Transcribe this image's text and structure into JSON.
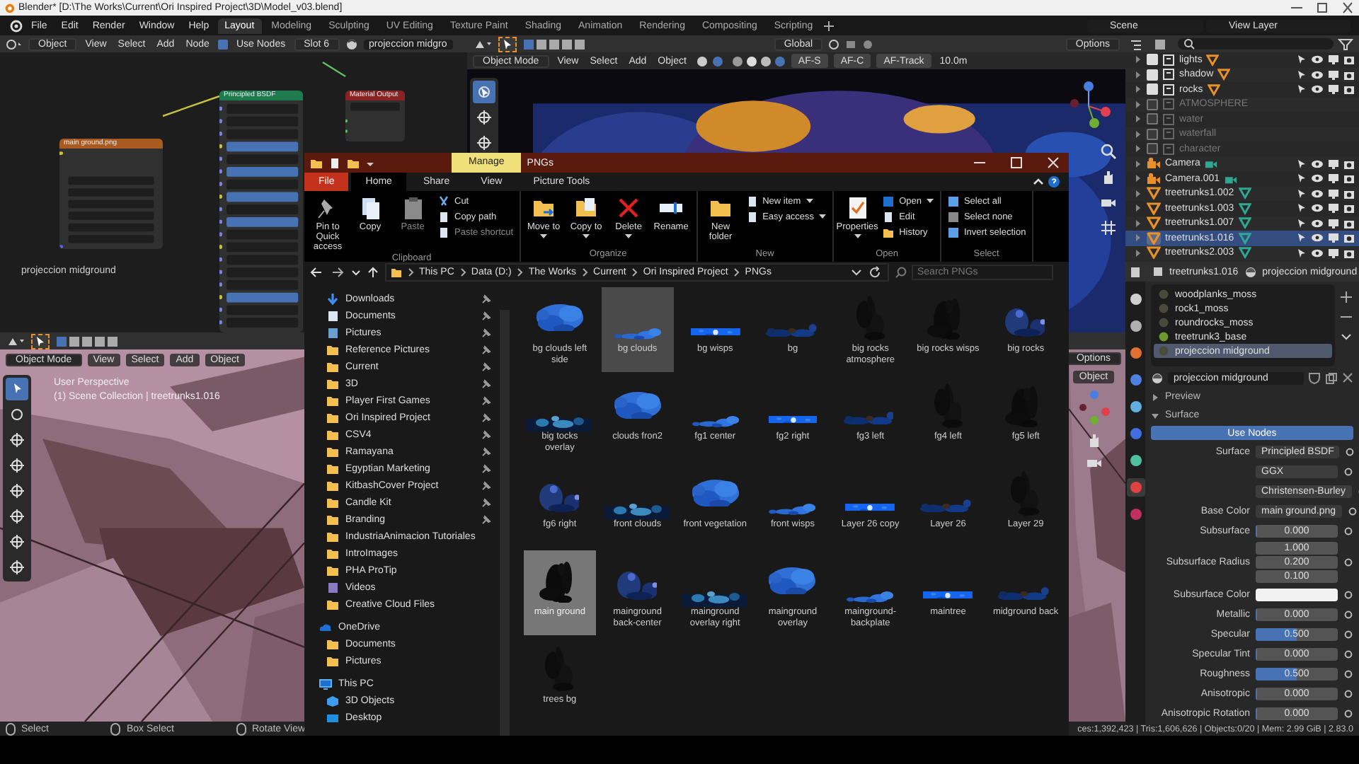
{
  "window": {
    "title": "Blender* [D:\\The Works\\Current\\Ori Inspired Project\\3D\\Model_v03.blend]"
  },
  "menu": [
    "File",
    "Edit",
    "Render",
    "Window",
    "Help"
  ],
  "workspaces": [
    {
      "label": "Layout",
      "selected": true
    },
    {
      "label": "Modeling",
      "selected": false
    },
    {
      "label": "Sculpting",
      "selected": false
    },
    {
      "label": "UV Editing",
      "selected": false
    },
    {
      "label": "Texture Paint",
      "selected": false
    },
    {
      "label": "Shading",
      "selected": false
    },
    {
      "label": "Animation",
      "selected": false
    },
    {
      "label": "Rendering",
      "selected": false
    },
    {
      "label": "Compositing",
      "selected": false
    },
    {
      "label": "Scripting",
      "selected": false
    }
  ],
  "scene": "Scene",
  "view_layer": "View Layer",
  "node_editor": {
    "object": "Object",
    "menus": [
      "View",
      "Select",
      "Add",
      "Node"
    ],
    "use_nodes": {
      "label": "Use Nodes",
      "checked": true
    },
    "slot": "Slot 6",
    "material": "projeccion midgro",
    "nodes": [
      {
        "title": "main ground.png",
        "kind": "texture"
      },
      {
        "title": "Principled BSDF",
        "kind": "shader"
      },
      {
        "title": "Material Output",
        "kind": "output"
      }
    ],
    "caption": "projeccion midground"
  },
  "viewport_main": {
    "orientation": "Global",
    "options": "Options",
    "mode": "Object Mode",
    "menus": [
      "View",
      "Select",
      "Add",
      "Object"
    ],
    "focus_buttons": [
      "AF-S",
      "AF-C",
      "AF-Track"
    ],
    "distance": "10.0m"
  },
  "viewport_left": {
    "mode": "Object Mode",
    "menus": [
      "View",
      "Select",
      "Add",
      "Object"
    ],
    "overlay": [
      "User Perspective",
      "(1) Scene Collection | treetrunks1.016"
    ]
  },
  "viewport_right": {
    "options": "Options",
    "menu": "Object"
  },
  "outliner": {
    "rows": [
      {
        "name": "lights",
        "kind": "collection",
        "checked": true,
        "selected": false
      },
      {
        "name": "shadow",
        "kind": "collection",
        "checked": true,
        "selected": false
      },
      {
        "name": "rocks",
        "kind": "collection",
        "checked": true,
        "selected": false
      },
      {
        "name": "ATMOSPHERE",
        "kind": "collection",
        "checked": false,
        "selected": false
      },
      {
        "name": "water",
        "kind": "collection",
        "checked": false,
        "selected": false
      },
      {
        "name": "waterfall",
        "kind": "collection",
        "checked": false,
        "selected": false
      },
      {
        "name": "character",
        "kind": "collection",
        "checked": false,
        "selected": false
      },
      {
        "name": "Camera",
        "kind": "camera",
        "checked": true,
        "selected": false
      },
      {
        "name": "Camera.001",
        "kind": "camera",
        "checked": true,
        "selected": false
      },
      {
        "name": "treetrunks1.002",
        "kind": "mesh",
        "checked": true,
        "selected": false
      },
      {
        "name": "treetrunks1.003",
        "kind": "mesh",
        "checked": true,
        "selected": false
      },
      {
        "name": "treetrunks1.007",
        "kind": "mesh",
        "checked": true,
        "selected": false
      },
      {
        "name": "treetrunks1.016",
        "kind": "mesh",
        "checked": true,
        "selected": true
      },
      {
        "name": "treetrunks2.003",
        "kind": "mesh",
        "checked": true,
        "selected": false
      }
    ]
  },
  "properties": {
    "object": "treetrunks1.016",
    "material": "projeccion midground",
    "slots": [
      {
        "name": "woodplanks_moss",
        "selected": false
      },
      {
        "name": "rock1_moss",
        "selected": false
      },
      {
        "name": "roundrocks_moss",
        "selected": false
      },
      {
        "name": "treetrunk3_base",
        "selected": false
      },
      {
        "name": "projeccion midground",
        "selected": true
      }
    ],
    "material_field": "projeccion midground",
    "panels": [
      {
        "label": "Preview",
        "expanded": false
      },
      {
        "label": "Surface",
        "expanded": true
      }
    ],
    "use_nodes": "Use Nodes",
    "rows": [
      {
        "kind": "link",
        "label": "Surface",
        "value": "Principled BSDF"
      },
      {
        "kind": "dropdown",
        "value": "GGX"
      },
      {
        "kind": "dropdown",
        "value": "Christensen-Burley"
      },
      {
        "kind": "link",
        "label": "Base Color",
        "value": "main ground.png"
      },
      {
        "kind": "number",
        "label": "Subsurface",
        "value": "0.000",
        "level": 0
      },
      {
        "kind": "vector",
        "label": "Subsurface Radius",
        "values": [
          "1.000",
          "0.200",
          "0.100"
        ]
      },
      {
        "kind": "color",
        "label": "Subsurface Color",
        "color": "#f2f2f2"
      },
      {
        "kind": "number",
        "label": "Metallic",
        "value": "0.000",
        "level": 0
      },
      {
        "kind": "number",
        "label": "Specular",
        "value": "0.500",
        "level": 0.5
      },
      {
        "kind": "number",
        "label": "Specular Tint",
        "value": "0.000",
        "level": 0
      },
      {
        "kind": "number",
        "label": "Roughness",
        "value": "0.500",
        "level": 0.5
      },
      {
        "kind": "number",
        "label": "Anisotropic",
        "value": "0.000",
        "level": 0
      },
      {
        "kind": "number",
        "label": "Anisotropic Rotation",
        "value": "0.000",
        "level": 0
      }
    ]
  },
  "status_bar": {
    "items": [
      "Select",
      "Box Select",
      "Rotate View"
    ],
    "stats": "ces:1,392,423 | Tris:1,606,626 | Objects:0/20 | Mem: 2.99 GiB | 2.83.0"
  },
  "explorer": {
    "title": "PNGs",
    "context_tab": "Manage",
    "tabs": [
      {
        "label": "File",
        "kind": "file",
        "selected": false
      },
      {
        "label": "Home",
        "kind": "tab",
        "selected": true
      },
      {
        "label": "Share",
        "kind": "tab",
        "selected": false
      },
      {
        "label": "View",
        "kind": "tab",
        "selected": false
      },
      {
        "label": "Picture Tools",
        "kind": "tab",
        "selected": false
      }
    ],
    "groups": [
      {
        "name": "Clipboard",
        "buttons": [
          {
            "label": "Pin to Quick access",
            "kind": "large",
            "dropdown": false,
            "disabled": false
          },
          {
            "label": "Copy",
            "kind": "large",
            "dropdown": false,
            "disabled": false
          },
          {
            "label": "Paste",
            "kind": "large",
            "dropdown": false,
            "disabled": true
          },
          {
            "label": "Cut",
            "kind": "small",
            "dropdown": false,
            "disabled": false
          },
          {
            "label": "Copy path",
            "kind": "small",
            "dropdown": false,
            "disabled": false
          },
          {
            "label": "Paste shortcut",
            "kind": "small",
            "dropdown": false,
            "disabled": true
          }
        ]
      },
      {
        "name": "Organize",
        "buttons": [
          {
            "label": "Move to",
            "kind": "large",
            "dropdown": true,
            "disabled": false
          },
          {
            "label": "Copy to",
            "kind": "large",
            "dropdown": true,
            "disabled": false
          },
          {
            "label": "Delete",
            "kind": "large",
            "dropdown": true,
            "disabled": false
          },
          {
            "label": "Rename",
            "kind": "large",
            "dropdown": false,
            "disabled": false
          }
        ]
      },
      {
        "name": "New",
        "buttons": [
          {
            "label": "New folder",
            "kind": "large",
            "dropdown": false,
            "disabled": false
          },
          {
            "label": "New item",
            "kind": "small",
            "dropdown": true,
            "disabled": false
          },
          {
            "label": "Easy access",
            "kind": "small",
            "dropdown": true,
            "disabled": false
          }
        ]
      },
      {
        "name": "Open",
        "buttons": [
          {
            "label": "Properties",
            "kind": "large",
            "dropdown": true,
            "disabled": false
          },
          {
            "label": "Open",
            "kind": "small",
            "dropdown": true,
            "disabled": false
          },
          {
            "label": "Edit",
            "kind": "small",
            "dropdown": false,
            "disabled": false
          },
          {
            "label": "History",
            "kind": "small",
            "dropdown": false,
            "disabled": false
          }
        ]
      },
      {
        "name": "Select",
        "buttons": [
          {
            "label": "Select all",
            "kind": "small",
            "dropdown": false,
            "disabled": false
          },
          {
            "label": "Select none",
            "kind": "small",
            "dropdown": false,
            "disabled": false
          },
          {
            "label": "Invert selection",
            "kind": "small",
            "dropdown": false,
            "disabled": false
          }
        ]
      }
    ],
    "path": [
      "This PC",
      "Data (D:)",
      "The Works",
      "Current",
      "Ori Inspired Project",
      "PNGs"
    ],
    "search": {
      "placeholder": "Search PNGs"
    },
    "nav": [
      {
        "label": "Downloads",
        "kind": "download",
        "pinned": true
      },
      {
        "label": "Documents",
        "kind": "document",
        "pinned": true
      },
      {
        "label": "Pictures",
        "kind": "pictures",
        "pinned": true
      },
      {
        "label": "Reference Pictures",
        "kind": "folder",
        "pinned": true
      },
      {
        "label": "Current",
        "kind": "folder",
        "pinned": true
      },
      {
        "label": "3D",
        "kind": "folder",
        "pinned": true
      },
      {
        "label": "Player First Games",
        "kind": "folder",
        "pinned": true
      },
      {
        "label": "Ori Inspired Project",
        "kind": "folder",
        "pinned": true
      },
      {
        "label": "CSV4",
        "kind": "folder",
        "pinned": true
      },
      {
        "label": "Ramayana",
        "kind": "folder",
        "pinned": true
      },
      {
        "label": "Egyptian Marketing",
        "kind": "folder",
        "pinned": true
      },
      {
        "label": "KitbashCover Project",
        "kind": "folder",
        "pinned": true
      },
      {
        "label": "Candle Kit",
        "kind": "folder",
        "pinned": true
      },
      {
        "label": "Branding",
        "kind": "folder",
        "pinned": true
      },
      {
        "label": "IndustriaAnimacion Tutoriales",
        "kind": "folder",
        "pinned": false
      },
      {
        "label": "IntroImages",
        "kind": "folder",
        "pinned": false
      },
      {
        "label": "PHA ProTip",
        "kind": "folder",
        "pinned": false
      },
      {
        "label": "Videos",
        "kind": "videos",
        "pinned": false
      },
      {
        "label": "Creative Cloud Files",
        "kind": "folder",
        "pinned": false
      },
      {
        "label": "OneDrive",
        "kind": "cloud",
        "pinned": false,
        "children": [
          {
            "label": "Documents",
            "kind": "folder"
          },
          {
            "label": "Pictures",
            "kind": "folder"
          }
        ]
      },
      {
        "label": "This PC",
        "kind": "pc",
        "pinned": false,
        "children": [
          {
            "label": "3D Objects",
            "kind": "cube"
          },
          {
            "label": "Desktop",
            "kind": "desktop"
          }
        ]
      }
    ],
    "files": [
      {
        "name": "bg clouds left side",
        "selected": false,
        "hover": false
      },
      {
        "name": "bg clouds",
        "selected": false,
        "hover": true
      },
      {
        "name": "bg wisps",
        "selected": false,
        "hover": false
      },
      {
        "name": "bg",
        "selected": false,
        "hover": false
      },
      {
        "name": "big rocks atmosphere",
        "selected": false,
        "hover": false
      },
      {
        "name": "big rocks wisps",
        "selected": false,
        "hover": false
      },
      {
        "name": "big rocks",
        "selected": false,
        "hover": false
      },
      {
        "name": "big tocks overlay",
        "selected": false,
        "hover": false
      },
      {
        "name": "clouds fron2",
        "selected": false,
        "hover": false
      },
      {
        "name": "fg1 center",
        "selected": false,
        "hover": false
      },
      {
        "name": "fg2 right",
        "selected": false,
        "hover": false
      },
      {
        "name": "fg3 left",
        "selected": false,
        "hover": false
      },
      {
        "name": "fg4 left",
        "selected": false,
        "hover": false
      },
      {
        "name": "fg5 left",
        "selected": false,
        "hover": false
      },
      {
        "name": "fg6 right",
        "selected": false,
        "hover": false
      },
      {
        "name": "front clouds",
        "selected": false,
        "hover": false
      },
      {
        "name": "front vegetation",
        "selected": false,
        "hover": false
      },
      {
        "name": "front wisps",
        "selected": false,
        "hover": false
      },
      {
        "name": "Layer 26 copy",
        "selected": false,
        "hover": false
      },
      {
        "name": "Layer 26",
        "selected": false,
        "hover": false
      },
      {
        "name": "Layer 29",
        "selected": false,
        "hover": false
      },
      {
        "name": "main ground",
        "selected": true,
        "hover": false
      },
      {
        "name": "mainground back-center",
        "selected": false,
        "hover": false
      },
      {
        "name": "mainground overlay right",
        "selected": false,
        "hover": false
      },
      {
        "name": "mainground overlay",
        "selected": false,
        "hover": false
      },
      {
        "name": "mainground-backplate",
        "selected": false,
        "hover": false
      },
      {
        "name": "maintree",
        "selected": false,
        "hover": false
      },
      {
        "name": "midground back",
        "selected": false,
        "hover": false
      },
      {
        "name": "trees bg",
        "selected": false,
        "hover": false
      }
    ]
  }
}
